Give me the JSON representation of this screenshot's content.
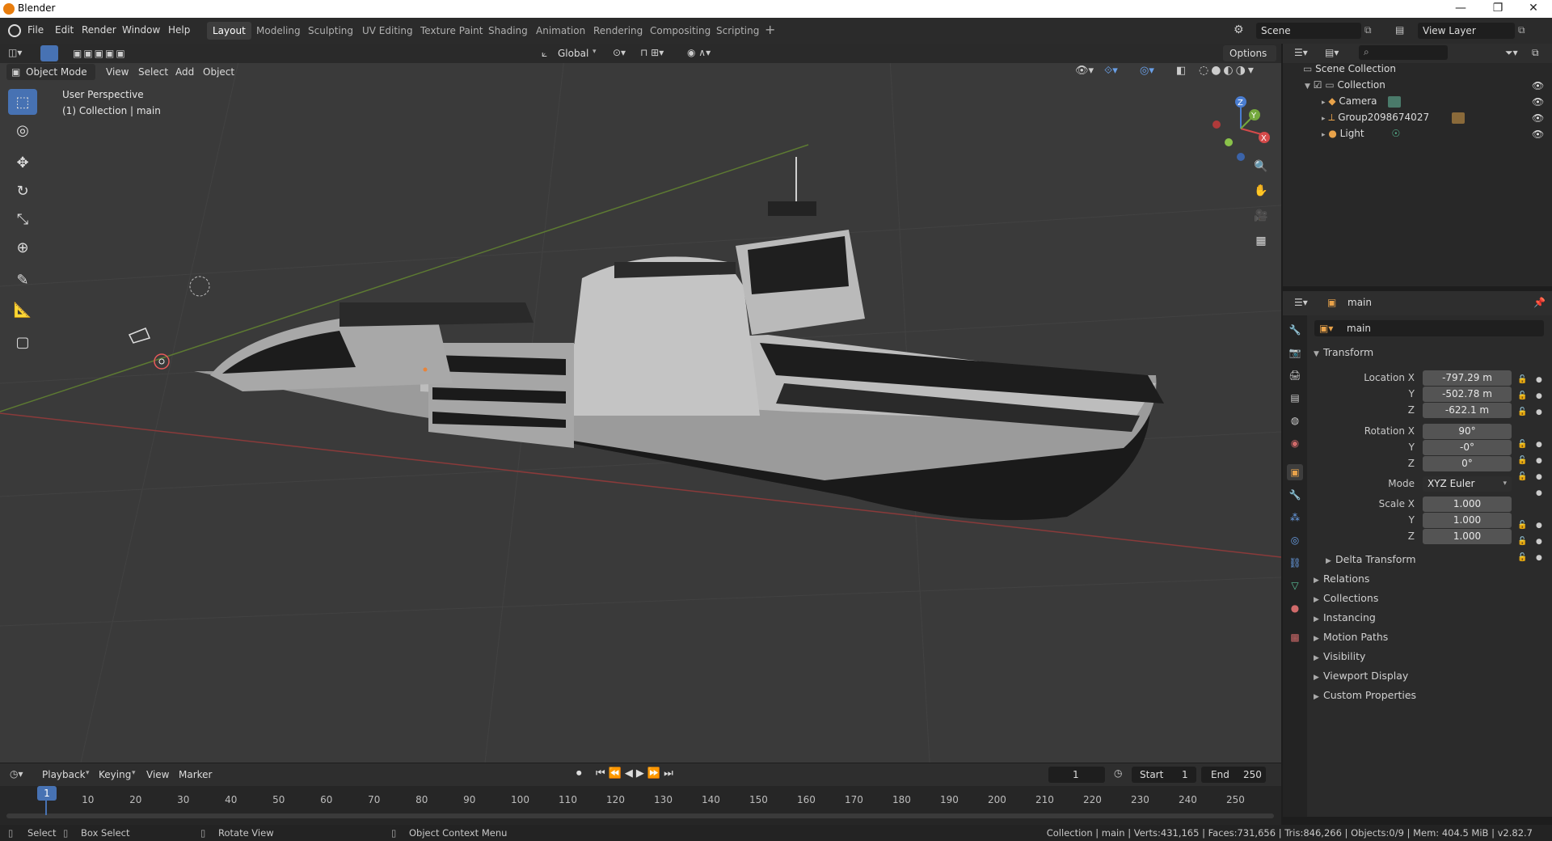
{
  "window": {
    "title": "Blender",
    "min": "—",
    "max": "❐",
    "close": "✕"
  },
  "menus": [
    "File",
    "Edit",
    "Render",
    "Window",
    "Help"
  ],
  "workspaces": [
    "Layout",
    "Modeling",
    "Sculpting",
    "UV Editing",
    "Texture Paint",
    "Shading",
    "Animation",
    "Rendering",
    "Compositing",
    "Scripting"
  ],
  "add_workspace": "+",
  "scene": {
    "label": "Scene",
    "view_layer": "View Layer"
  },
  "viewport": {
    "mode": "Object Mode",
    "menus": [
      "View",
      "Select",
      "Add",
      "Object"
    ],
    "transform_orientation": "Global",
    "options": "Options",
    "overlay_title": "User Perspective",
    "overlay_sub": "(1) Collection | main"
  },
  "outliner": {
    "root": "Scene Collection",
    "collection": "Collection",
    "items": [
      {
        "name": "Camera",
        "icon": "camera-icon"
      },
      {
        "name": "Group2098674027",
        "icon": "empty-icon"
      },
      {
        "name": "Light",
        "icon": "light-icon"
      }
    ]
  },
  "properties": {
    "object_name": "main",
    "datablock": "main",
    "transform_title": "Transform",
    "location_x_label": "Location X",
    "location_x": "-797.29 m",
    "location_y_label": "Y",
    "location_y": "-502.78 m",
    "location_z_label": "Z",
    "location_z": "-622.1 m",
    "rotation_x_label": "Rotation X",
    "rotation_x": "90°",
    "rotation_y_label": "Y",
    "rotation_y": "-0°",
    "rotation_z_label": "Z",
    "rotation_z": "0°",
    "mode_label": "Mode",
    "mode": "XYZ Euler",
    "scale_x_label": "Scale X",
    "scale_x": "1.000",
    "scale_y_label": "Y",
    "scale_y": "1.000",
    "scale_z_label": "Z",
    "scale_z": "1.000",
    "delta": "Delta Transform",
    "sections": [
      "Relations",
      "Collections",
      "Instancing",
      "Motion Paths",
      "Visibility",
      "Viewport Display",
      "Custom Properties"
    ]
  },
  "timeline": {
    "menus": [
      "Playback",
      "Keying",
      "View",
      "Marker"
    ],
    "current_frame": "1",
    "start_label": "Start",
    "start": "1",
    "end_label": "End",
    "end": "250",
    "ticks": [
      "1",
      "10",
      "20",
      "30",
      "40",
      "50",
      "60",
      "70",
      "80",
      "90",
      "100",
      "110",
      "120",
      "130",
      "140",
      "150",
      "160",
      "170",
      "180",
      "190",
      "200",
      "210",
      "220",
      "230",
      "240",
      "250"
    ]
  },
  "status": {
    "select": "Select",
    "box_select": "Box Select",
    "rotate_view": "Rotate View",
    "context_menu": "Object Context Menu",
    "stats": "Collection | main | Verts:431,165 | Faces:731,656 | Tris:846,266 | Objects:0/9 | Mem: 404.5 MiB | v2.82.7"
  },
  "gizmo": {
    "x": "X",
    "y": "Y",
    "z": "Z"
  }
}
